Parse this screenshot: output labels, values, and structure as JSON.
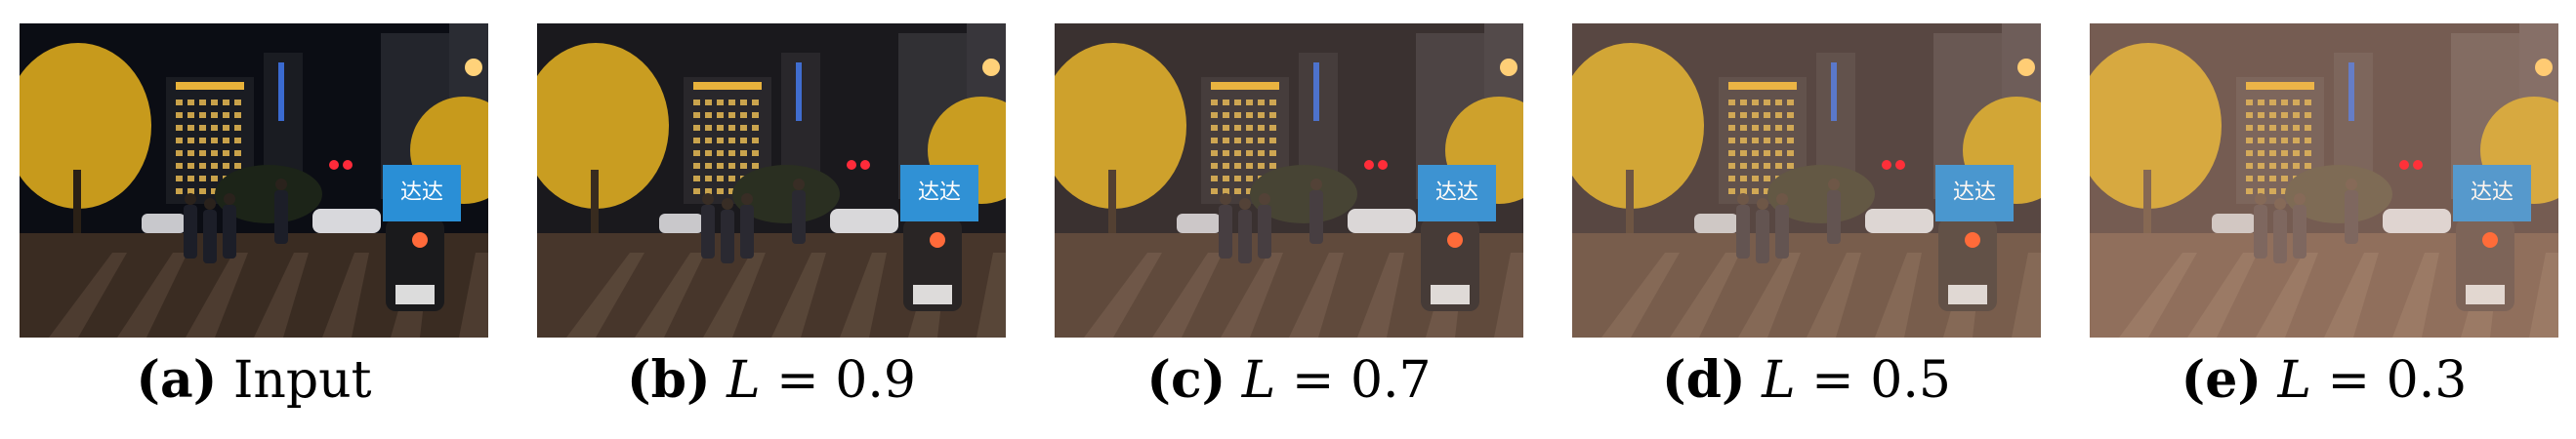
{
  "panels": [
    {
      "letter": "(a)",
      "text": "Input",
      "var": "",
      "eq": "",
      "value": "",
      "brightness": 0.0
    },
    {
      "letter": "(b)",
      "text": "",
      "var": "L",
      "eq": " = ",
      "value": "0.9",
      "brightness": 0.1
    },
    {
      "letter": "(c)",
      "text": "",
      "var": "L",
      "eq": " = ",
      "value": "0.7",
      "brightness": 0.3
    },
    {
      "letter": "(d)",
      "text": "",
      "var": "L",
      "eq": " = ",
      "value": "0.5",
      "brightness": 0.5
    },
    {
      "letter": "(e)",
      "text": "",
      "var": "L",
      "eq": " = ",
      "value": "0.3",
      "brightness": 0.7
    }
  ],
  "scene": {
    "sign_text": "达达",
    "sign_color": "#2a8fd6",
    "sky_color": "#0b0d14",
    "tree_color": "#c79a1c",
    "road_color": "#3a2c22"
  }
}
